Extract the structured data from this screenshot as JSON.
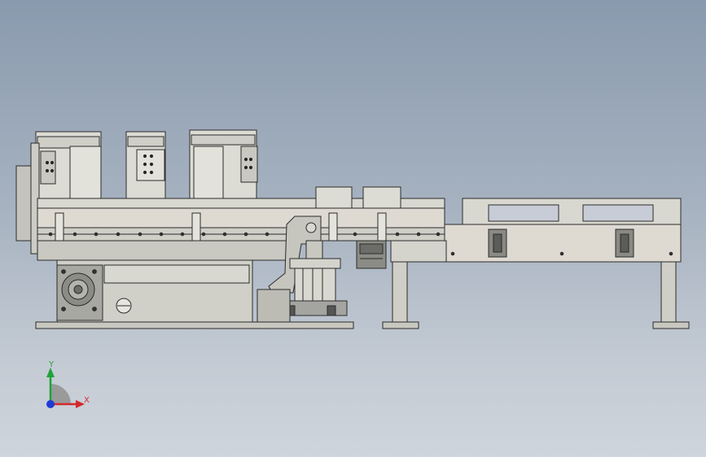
{
  "scene": {
    "type": "cad-assembly-side-view",
    "background_top": "#8a9aae",
    "background_bottom": "#cfd5dc"
  },
  "triad": {
    "y_label": "Y",
    "x_label": "X",
    "y_color": "#1fa33a",
    "x_color": "#d42a2a",
    "z_color": "#1f3bd6",
    "plane_color": "#9a9a9a"
  },
  "machine": {
    "body_color": "#d4d4cc",
    "frame_color": "#c8c8c0",
    "motor_color": "#8c8c86",
    "line_color": "#2b2b2b"
  }
}
